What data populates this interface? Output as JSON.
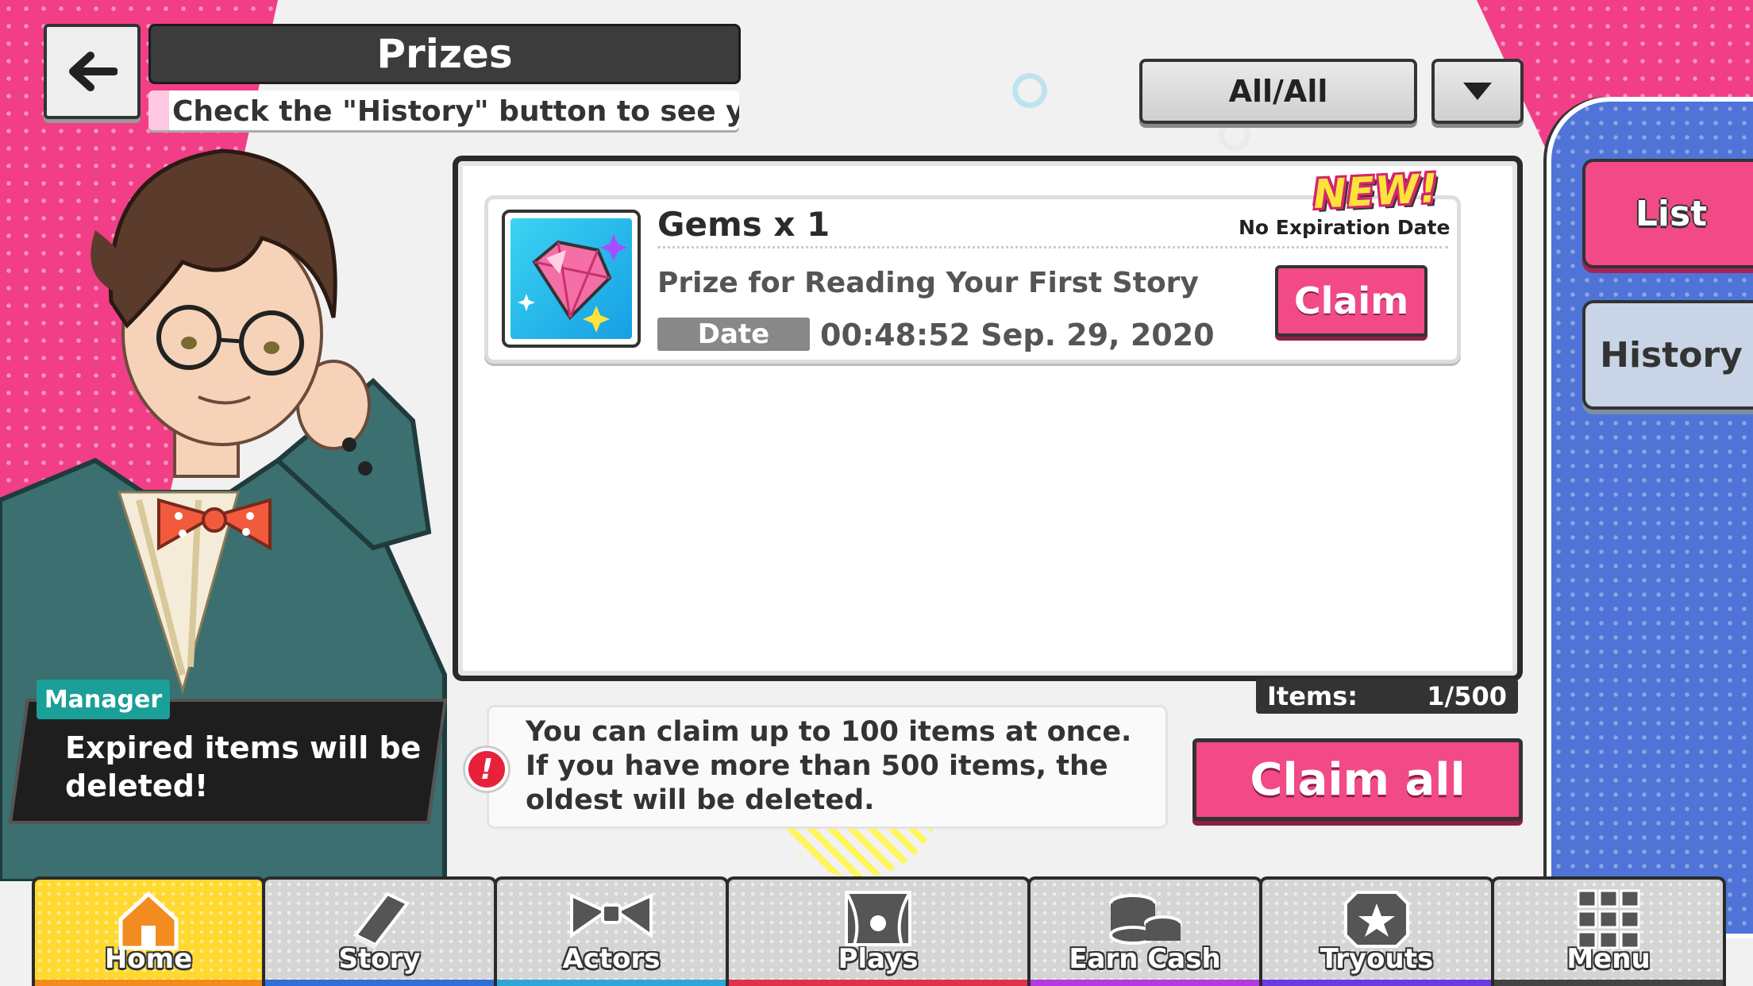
{
  "header": {
    "title": "Prizes",
    "ticker": "Check the \"History\" button to see yo",
    "filter_label": "All/All"
  },
  "side_tabs": {
    "list": "List",
    "history": "History"
  },
  "prizes": [
    {
      "name": "Gems x 1",
      "badge": "NEW!",
      "expiration": "No Expiration Date",
      "description": "Prize for Reading Your First Story",
      "date_label": "Date",
      "date_value": "00:48:52 Sep. 29, 2020",
      "claim_label": "Claim",
      "icon": "gem-icon"
    }
  ],
  "items_counter": {
    "label": "Items:",
    "value": "1/500"
  },
  "notice": {
    "line1": "You can claim up to 100 items at once.",
    "line2": "If you have more than 500 items, the",
    "line3": "oldest will be deleted."
  },
  "claim_all_label": "Claim all",
  "character": {
    "role": "Manager",
    "speech": "Expired items will be deleted!"
  },
  "nav": [
    {
      "label": "Home",
      "icon": "home-icon",
      "color": "#f28c1e",
      "active": true
    },
    {
      "label": "Story",
      "icon": "book-icon",
      "color": "#2f6fd6"
    },
    {
      "label": "Actors",
      "icon": "bowtie-icon",
      "color": "#2fa6d6"
    },
    {
      "label": "Plays",
      "icon": "theater-icon",
      "color": "#e0314b"
    },
    {
      "label": "Earn Cash",
      "icon": "coins-icon",
      "color": "#b13be0"
    },
    {
      "label": "Tryouts",
      "icon": "star-badge-icon",
      "color": "#6a3be0"
    },
    {
      "label": "Menu",
      "icon": "grid-menu-icon",
      "color": "#444444"
    }
  ],
  "colors": {
    "accent_pink": "#f24a86",
    "background_pink": "#f23e86",
    "panel_blue": "#4f73d6",
    "nav_active": "#ffd92f"
  }
}
